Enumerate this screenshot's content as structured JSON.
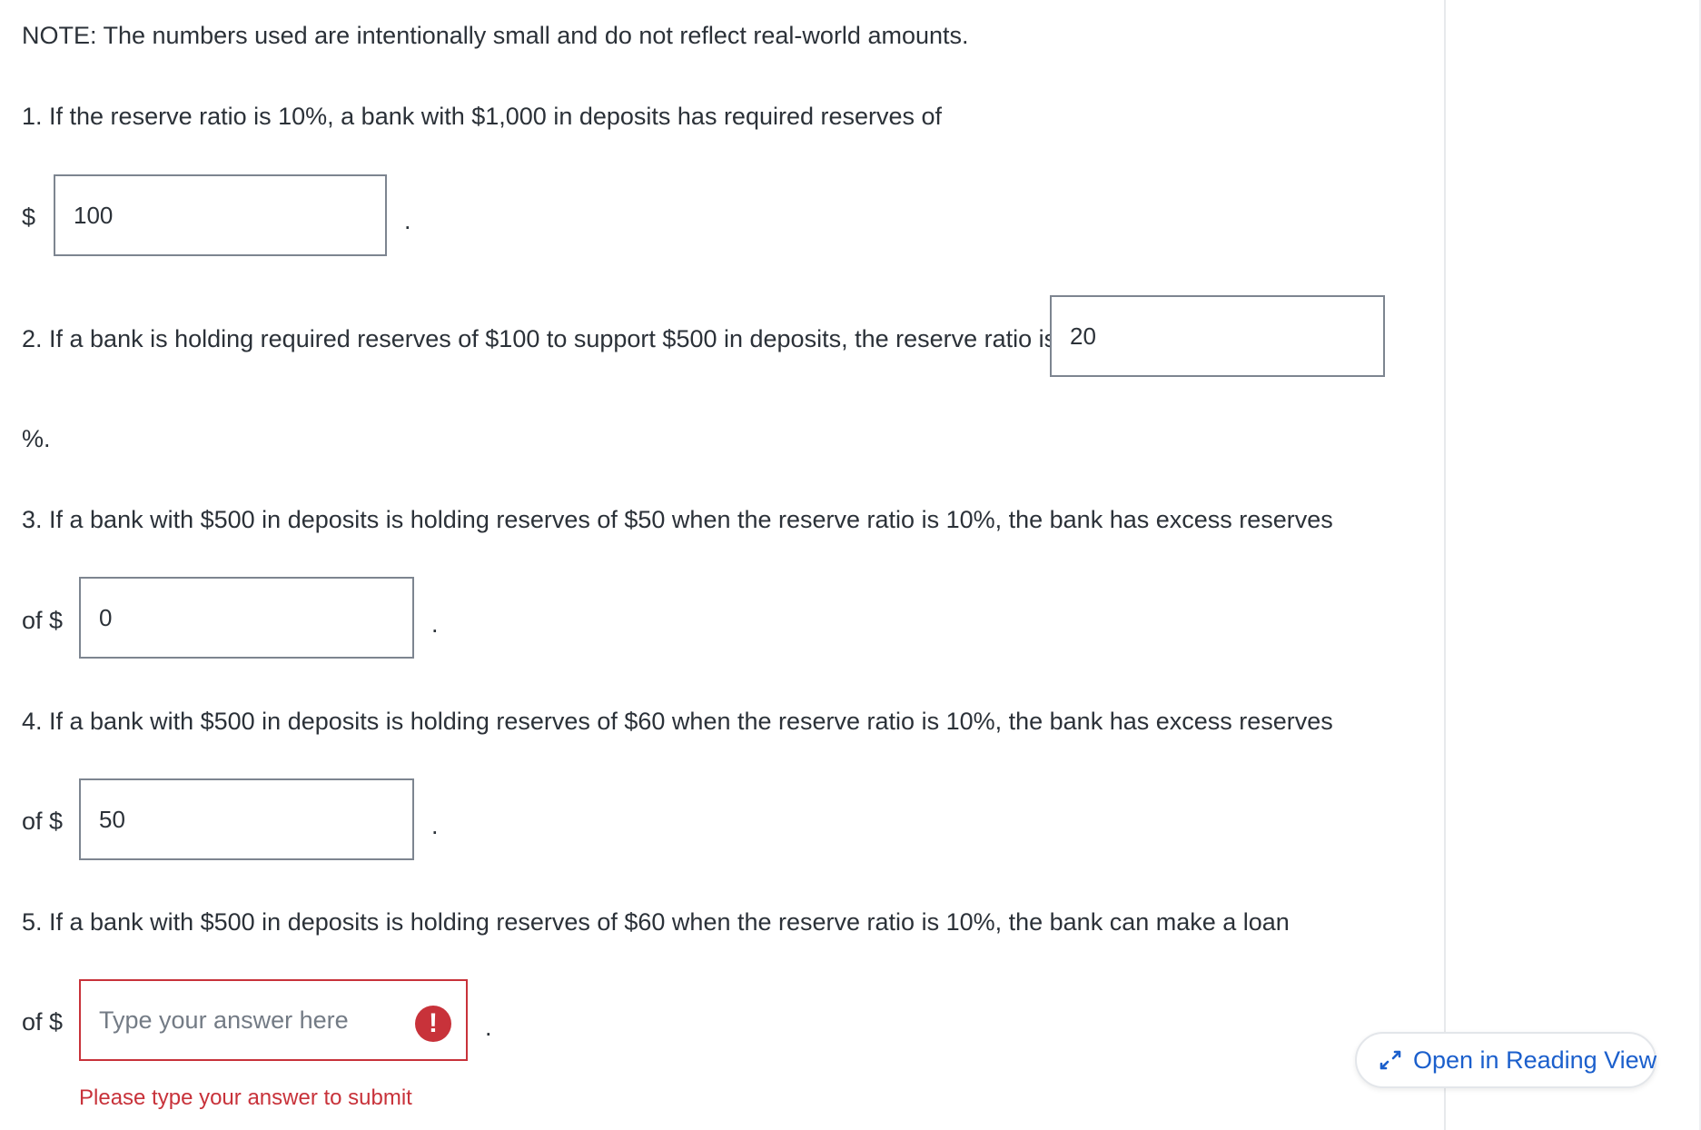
{
  "note": "NOTE: The numbers used are intentionally small and do not reflect real-world amounts.",
  "q1": {
    "text": "1. If the reserve ratio is 10%, a bank with $1,000 in deposits has required reserves of",
    "prefix": "$",
    "value": "100",
    "suffix": "."
  },
  "q2": {
    "text": "2. If a bank is holding required reserves of $100 to support $500 in deposits, the reserve ratio is",
    "value": "20",
    "suffix": "%."
  },
  "q3": {
    "text": "3. If a bank with $500 in deposits is holding reserves of $50 when the reserve ratio is 10%, the bank has excess reserves",
    "prefix": "of $",
    "value": "0",
    "suffix": "."
  },
  "q4": {
    "text": "4. If a bank with $500 in deposits is holding reserves of $60 when the reserve ratio is 10%, the bank has excess reserves",
    "prefix": "of $",
    "value": "50",
    "suffix": "."
  },
  "q5": {
    "text": "5. If a bank with $500 in deposits is holding reserves of $60 when the reserve ratio is 10%, the bank can make a loan",
    "prefix": "of $",
    "value": "",
    "placeholder": "Type your answer here",
    "error_icon": "!",
    "suffix": ".",
    "error_message": "Please type your answer to submit"
  },
  "reading_view": {
    "label": "Open in Reading View",
    "icon": "expand-arrows-icon"
  },
  "colors": {
    "text": "#2b3138",
    "input_border": "#7d8590",
    "error": "#c8323a",
    "link": "#1b5fcc"
  }
}
